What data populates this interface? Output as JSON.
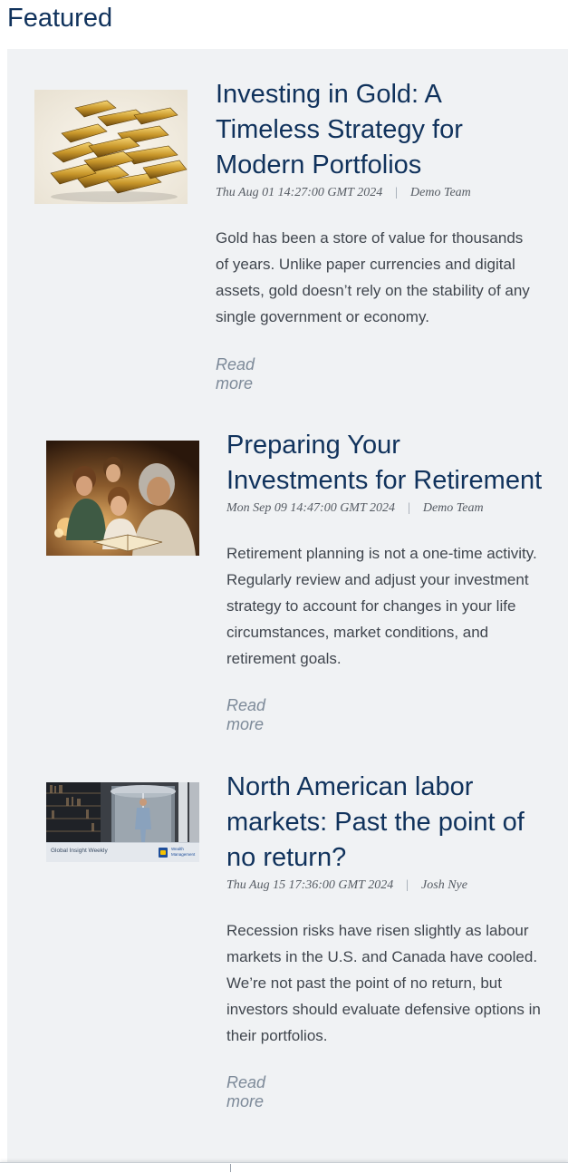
{
  "section": {
    "title": "Featured"
  },
  "articles": [
    {
      "image_icon": "gold-bars-image",
      "title_lines": [
        "Investing in Gold: A",
        "Timeless Strategy for",
        "Modern Portfolios"
      ],
      "date": "Thu Aug 01 14:27:00 GMT 2024",
      "separator": "|",
      "author": "Demo Team",
      "excerpt_lines": [
        "Gold has been a store of value for thousands",
        "of years. Unlike paper currencies and digital",
        "assets, gold doesn’t rely on the stability of any",
        "single government or economy."
      ],
      "read_more": "Read more"
    },
    {
      "image_icon": "grandmother-reading-image",
      "title_lines": [
        "Preparing Your",
        "Investments for Retirement"
      ],
      "date": "Mon Sep 09 14:47:00 GMT 2024",
      "separator": "|",
      "author": "Demo Team",
      "excerpt_lines": [
        "Retirement planning is not a one-time activity.",
        "Regularly review and adjust your investment",
        "strategy to account for changes in your life",
        "circumstances, market conditions, and",
        "retirement goals."
      ],
      "read_more": "Read more"
    },
    {
      "image_icon": "businessman-revolving-door-image",
      "image_caption": "Global Insight Weekly",
      "image_brand": "Wealth Management",
      "title_lines": [
        "North American labor",
        "markets: Past the point of",
        "no return?"
      ],
      "date": "Thu Aug 15 17:36:00 GMT 2024",
      "separator": "|",
      "author": "Josh Nye",
      "excerpt_lines": [
        "Recession risks have risen slightly as labour",
        "markets in the U.S. and Canada have cooled.",
        "We’re not past the point of no return, but",
        "investors should evaluate defensive options in",
        "their portfolios."
      ],
      "read_more": "Read more"
    }
  ],
  "colors": {
    "heading": "#10325c",
    "panel_bg": "#f0f2f4",
    "body_text": "#40464e",
    "link": "#7d8a99"
  }
}
